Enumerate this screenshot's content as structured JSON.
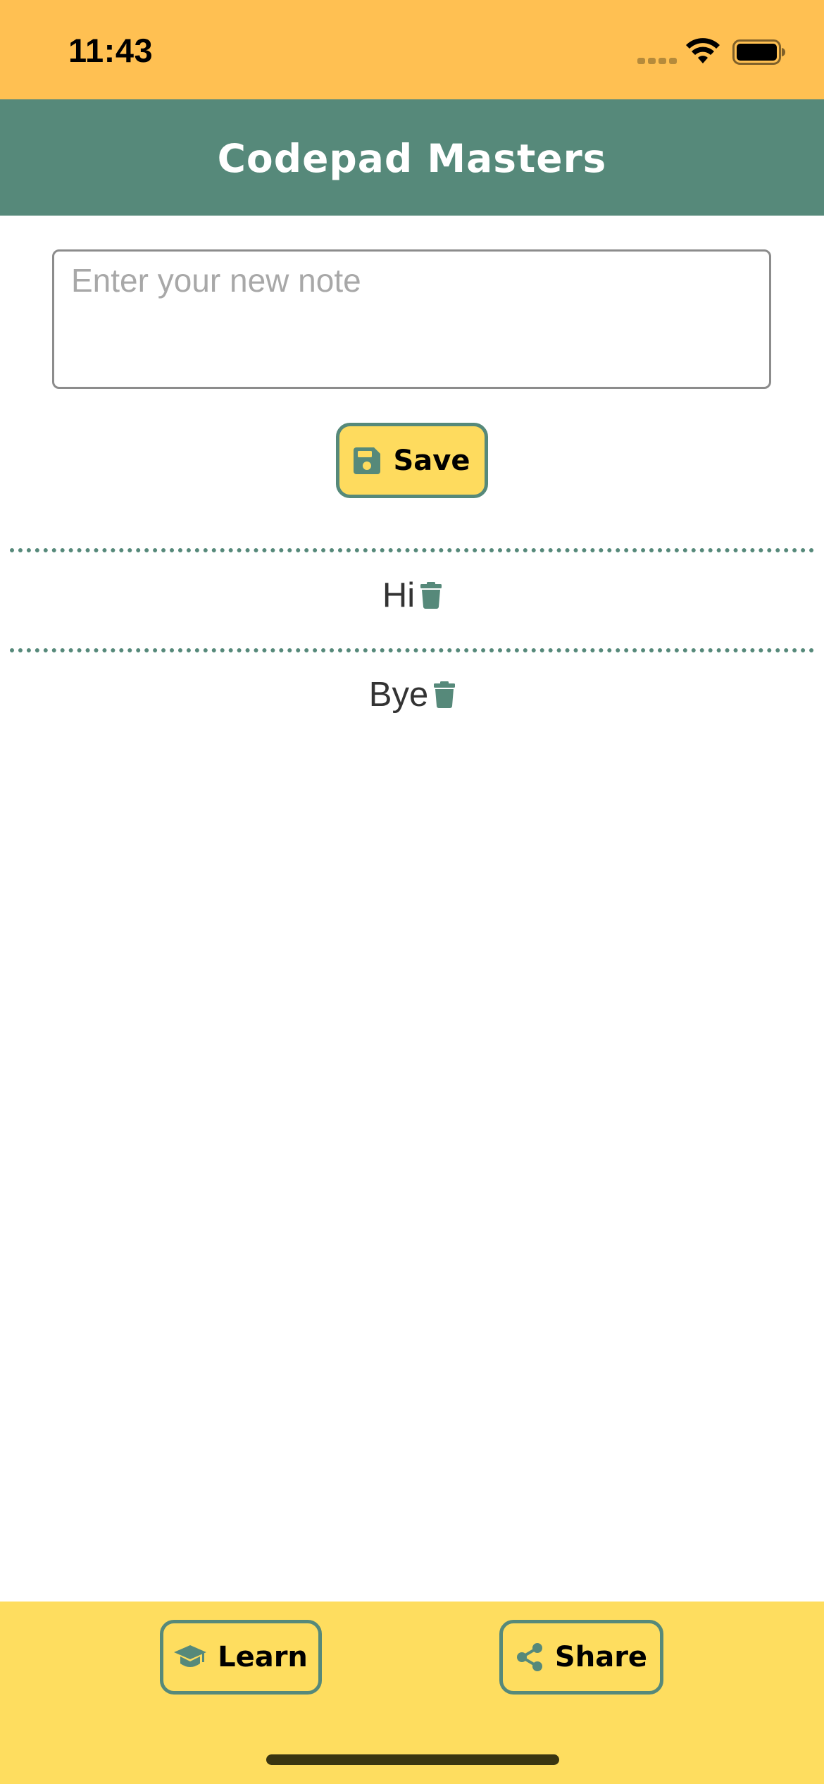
{
  "status_bar": {
    "time": "11:43"
  },
  "header": {
    "title": "Codepad Masters"
  },
  "note_input": {
    "placeholder": "Enter your new note",
    "value": ""
  },
  "save_button": {
    "label": "Save",
    "icon": "floppy-disk-icon"
  },
  "notes": [
    {
      "text": "Hi",
      "icon": "trash-icon"
    },
    {
      "text": "Bye",
      "icon": "trash-icon"
    }
  ],
  "bottom_nav": {
    "learn": {
      "label": "Learn",
      "icon": "graduation-cap-icon"
    },
    "share": {
      "label": "Share",
      "icon": "share-icon"
    }
  },
  "colors": {
    "status_bar": "#FFC052",
    "header": "#56897A",
    "accent_yellow": "#FEDB5E",
    "bottom_bar": "#FEDD5F",
    "text": "#333333"
  }
}
